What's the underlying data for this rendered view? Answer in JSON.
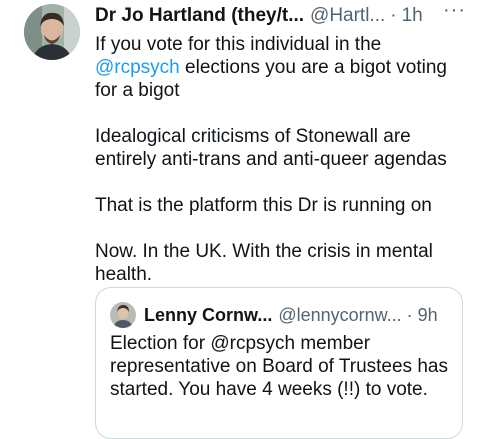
{
  "tweet": {
    "author_name": "Dr Jo Hartland (they/t...",
    "handle": "@Hartl...",
    "separator": "·",
    "time": "1h",
    "more_icon": "···",
    "text_line1_prefix": "If you vote for this individual in the ",
    "mention": "@rcpsych",
    "text_line1_suffix": " elections you are a bigot voting for a bigot",
    "paragraph2": "Idealogical criticisms of Stonewall are entirely anti-trans and anti-queer agendas",
    "paragraph3": "That is the platform this Dr is running on",
    "paragraph4": "Now. In the UK. With the crisis in mental health."
  },
  "quoted_tweet": {
    "author_name": "Lenny Cornw...",
    "handle": "@lennycornw...",
    "separator": "·",
    "time": "9h",
    "text": "Election for @rcpsych member representative on Board of Trustees has started.  You have 4 weeks (!!) to vote."
  },
  "colors": {
    "accent": "#1d9bf0",
    "secondary_text": "#536471",
    "border": "#cfd9de"
  }
}
